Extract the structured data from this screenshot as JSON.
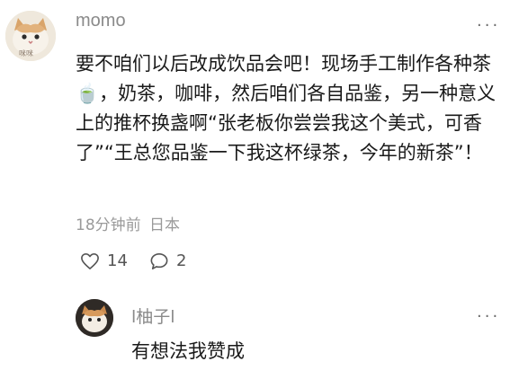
{
  "comment": {
    "author": "momo",
    "avatar_label": "咪咪",
    "text": "要不咱们以后改成饮品会吧！现场手工制作各种茶🍵，奶茶，咖啡，然后咱们各自品鉴，另一种意义上的推杯换盏啊“张老板你尝尝我这个美式，可香了”“王总您品鉴一下我这杯绿茶，今年的新茶”！",
    "time": "18分钟前",
    "location": "日本",
    "likes": "14",
    "replies": "2",
    "more_icon": "more-dots-icon"
  },
  "reply": {
    "author": "l柚子l",
    "text": "有想法我赞成",
    "more_icon": "more-dots-icon"
  }
}
